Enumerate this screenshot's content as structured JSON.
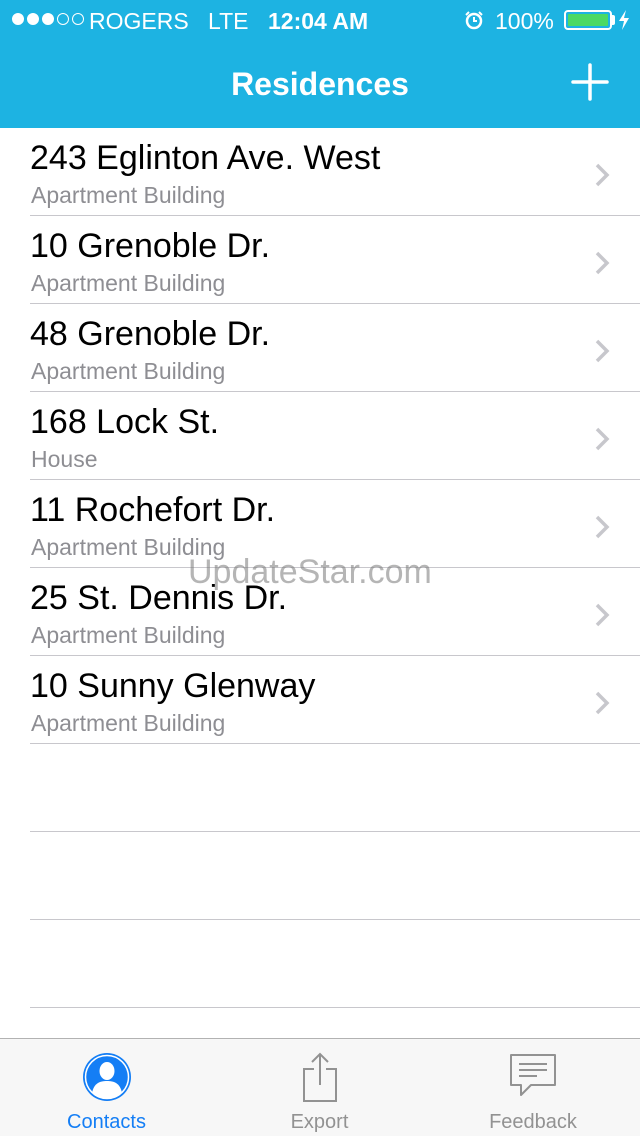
{
  "status_bar": {
    "carrier": "ROGERS",
    "network": "LTE",
    "time": "12:04 AM",
    "battery": "100%",
    "signal_strength": "3 of 5",
    "icons": [
      "signal-dots-icon",
      "alarm-icon",
      "battery-icon",
      "charging-bolt-icon"
    ]
  },
  "nav": {
    "title": "Residences",
    "add_icon": "plus-icon"
  },
  "residences": [
    {
      "address": "243 Eglinton Ave. West",
      "type": "Apartment Building"
    },
    {
      "address": "10 Grenoble Dr.",
      "type": "Apartment Building"
    },
    {
      "address": "48 Grenoble Dr.",
      "type": "Apartment Building"
    },
    {
      "address": "168 Lock St.",
      "type": "House"
    },
    {
      "address": "11 Rochefort Dr.",
      "type": "Apartment Building"
    },
    {
      "address": "25 St. Dennis Dr.",
      "type": "Apartment Building"
    },
    {
      "address": "10 Sunny Glenway",
      "type": "Apartment Building"
    }
  ],
  "watermark": "UpdateStar.com",
  "tabs": [
    {
      "label": "Contacts",
      "icon": "contact-person-icon",
      "active": true
    },
    {
      "label": "Export",
      "icon": "share-export-icon",
      "active": false
    },
    {
      "label": "Feedback",
      "icon": "speech-bubble-icon",
      "active": false
    }
  ],
  "colors": {
    "header": "#1db3e2",
    "active_tab": "#147ef5",
    "inactive_tab": "#929292",
    "battery_fill": "#4cd964",
    "subtitle": "#8e8e93",
    "separator": "#c8c7cc"
  }
}
